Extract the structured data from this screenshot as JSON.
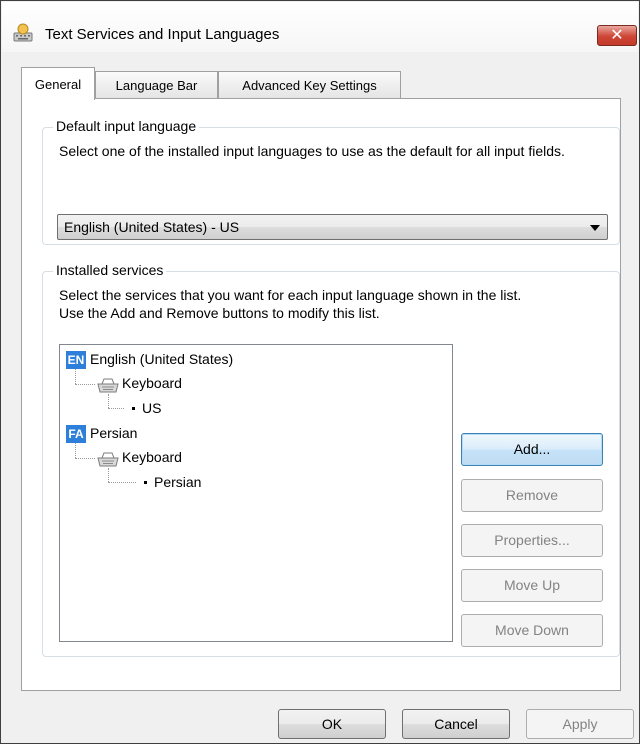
{
  "window": {
    "title": "Text Services and Input Languages",
    "close_label": "✕"
  },
  "tabs": [
    {
      "label": "General"
    },
    {
      "label": "Language Bar"
    },
    {
      "label": "Advanced Key Settings"
    }
  ],
  "default_input": {
    "legend": "Default input language",
    "description": "Select one of the installed input languages to use as the default for all input fields.",
    "selected": "English (United States) - US"
  },
  "installed_services": {
    "legend": "Installed services",
    "description_line1": "Select the services that you want for each input language shown in the list.",
    "description_line2": "Use the Add and Remove buttons to modify this list.",
    "languages": [
      {
        "code": "EN",
        "name": "English (United States)",
        "service": "Keyboard",
        "layout": "US"
      },
      {
        "code": "FA",
        "name": "Persian",
        "service": "Keyboard",
        "layout": "Persian"
      }
    ],
    "buttons": {
      "add": "Add...",
      "remove": "Remove",
      "properties": "Properties...",
      "move_up": "Move Up",
      "move_down": "Move Down"
    }
  },
  "footer": {
    "ok": "OK",
    "cancel": "Cancel",
    "apply": "Apply"
  },
  "colors": {
    "accent_badge": "#2d7fd9",
    "close_button": "#cd4535"
  }
}
